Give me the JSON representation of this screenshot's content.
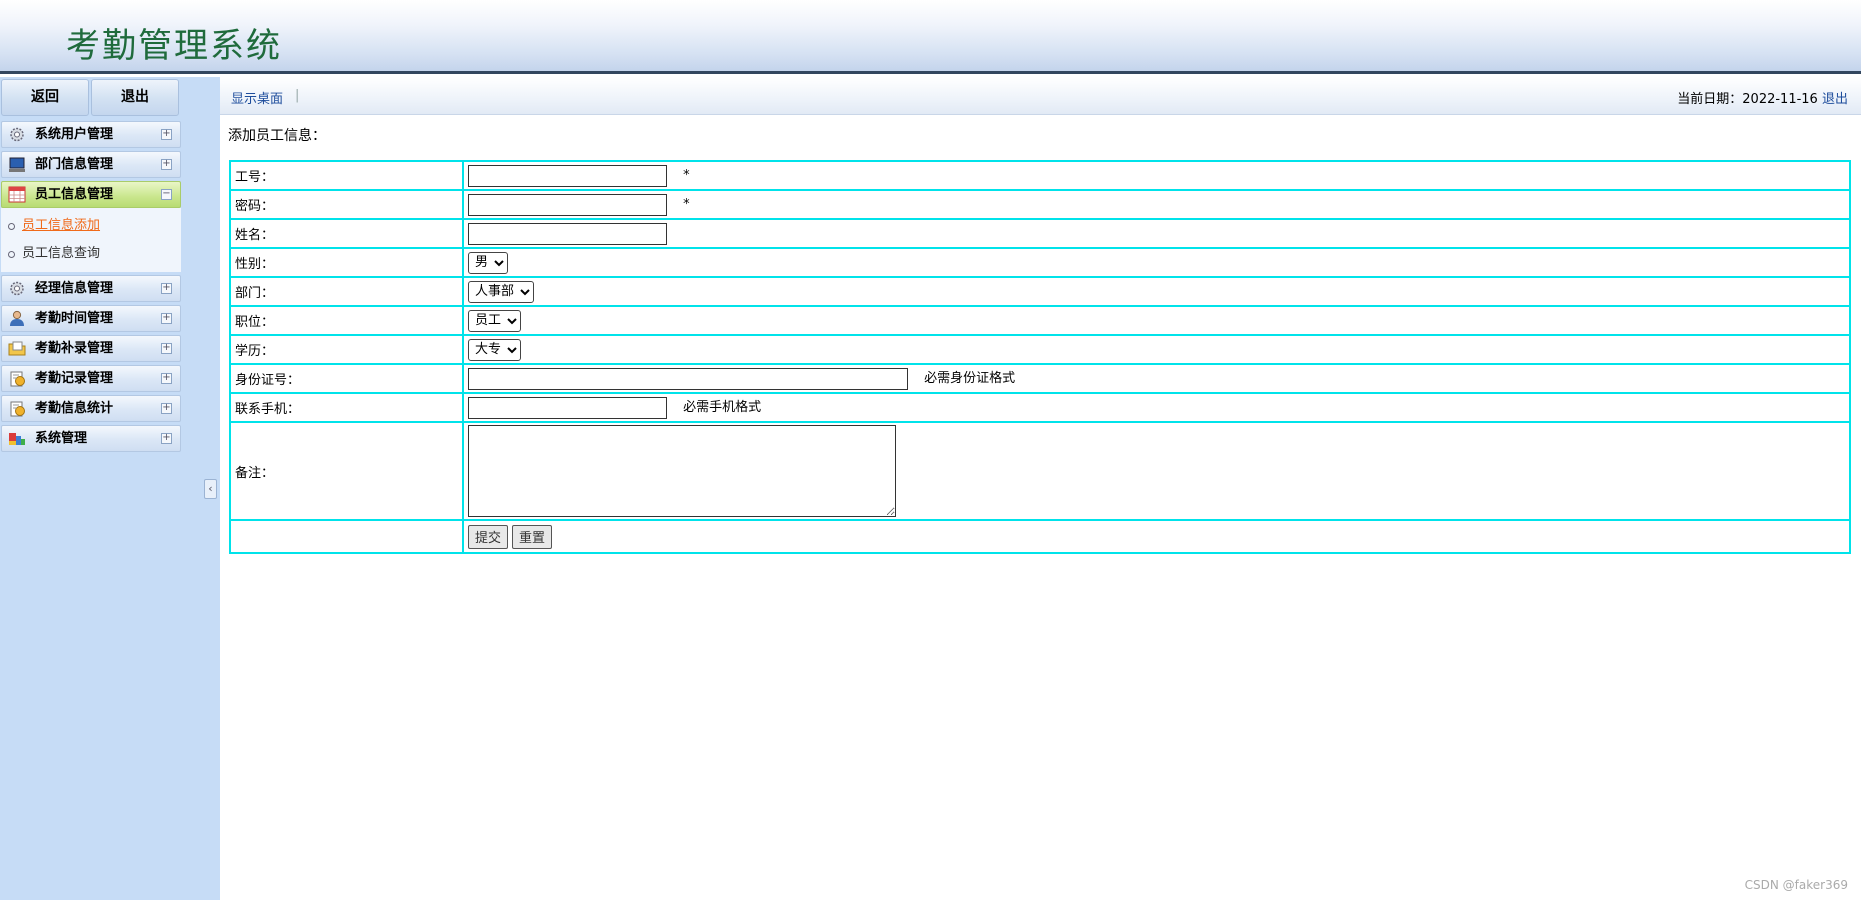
{
  "app": {
    "title": "考勤管理系统"
  },
  "sidebar": {
    "back_label": "返回",
    "exit_label": "退出",
    "menus": [
      {
        "label": "系统用户管理",
        "icon": "gear-icon",
        "toggle": "+"
      },
      {
        "label": "部门信息管理",
        "icon": "monitor-icon",
        "toggle": "+"
      },
      {
        "label": "员工信息管理",
        "icon": "calendar-icon",
        "toggle": "−",
        "expanded": true
      },
      {
        "label": "经理信息管理",
        "icon": "gear-icon",
        "toggle": "+"
      },
      {
        "label": "考勤时间管理",
        "icon": "person-icon",
        "toggle": "+"
      },
      {
        "label": "考勤补录管理",
        "icon": "folder-icon",
        "toggle": "+"
      },
      {
        "label": "考勤记录管理",
        "icon": "clipboard-icon",
        "toggle": "+"
      },
      {
        "label": "考勤信息统计",
        "icon": "clipboard-icon",
        "toggle": "+"
      },
      {
        "label": "系统管理",
        "icon": "blocks-icon",
        "toggle": "+"
      }
    ],
    "submenu": [
      {
        "label": "员工信息添加",
        "current": true
      },
      {
        "label": "员工信息查询"
      }
    ],
    "collapse_symbol": "‹"
  },
  "topbar": {
    "show_desktop": "显示桌面",
    "separator": "|",
    "date_label": "当前日期：",
    "date_value": "2022-11-16",
    "logout": "退出"
  },
  "form": {
    "title": "添加员工信息：",
    "fields": {
      "emp_no": {
        "label": "工号：",
        "value": "",
        "required_mark": "*"
      },
      "password": {
        "label": "密码：",
        "value": "",
        "required_mark": "*"
      },
      "name": {
        "label": "姓名：",
        "value": ""
      },
      "gender": {
        "label": "性别：",
        "selected": "男"
      },
      "department": {
        "label": "部门：",
        "selected": "人事部"
      },
      "position": {
        "label": "职位：",
        "selected": "员工"
      },
      "education": {
        "label": "学历：",
        "selected": "大专"
      },
      "id_card": {
        "label": "身份证号：",
        "value": "",
        "hint": "必需身份证格式"
      },
      "phone": {
        "label": "联系手机：",
        "value": "",
        "hint": "必需手机格式"
      },
      "remark": {
        "label": "备注：",
        "value": ""
      }
    },
    "submit_label": "提交",
    "reset_label": "重置"
  },
  "watermark": "CSDN @faker369",
  "colors": {
    "title_green": "#1f6b3c",
    "sidebar_bg": "#c6dcf6",
    "active_menu": "#c9e68c",
    "table_border": "#00e3ea",
    "link_blue": "#1e4d9c",
    "current_sub": "#f06a1a"
  }
}
